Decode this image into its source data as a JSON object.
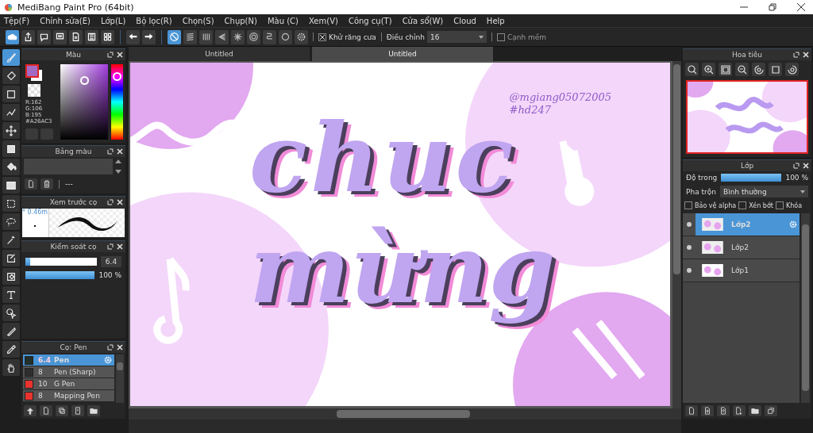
{
  "window": {
    "title": "MediBang Paint Pro (64bit)"
  },
  "menu": [
    "Tệp(F)",
    "Chỉnh sửa(E)",
    "Lớp(L)",
    "Bộ lọc(R)",
    "Chọn(S)",
    "Chụp(N)",
    "Màu (C)",
    "Xem(V)",
    "Công cụ(T)",
    "Cửa sổ(W)",
    "Cloud",
    "Help"
  ],
  "toolbar": {
    "snaps": [
      {
        "selected": true
      },
      {
        "selected": false
      },
      {
        "selected": false
      },
      {
        "selected": false
      },
      {
        "selected": false
      },
      {
        "selected": false
      },
      {
        "selected": false
      },
      {
        "selected": false
      }
    ],
    "antialias": {
      "label": "Khử răng cưa",
      "checked": true
    },
    "correction": {
      "label": "Điều chỉnh",
      "value": "16"
    },
    "soft_edge": {
      "label": "Cạnh mềm",
      "checked": false
    }
  },
  "tools": [
    {
      "selected": true
    },
    {
      "selected": false
    },
    {
      "selected": false
    },
    {
      "selected": false
    },
    {
      "selected": false
    },
    {
      "selected": false
    },
    {
      "selected": false
    },
    {
      "selected": false
    },
    {
      "selected": false
    },
    {
      "selected": false
    },
    {
      "selected": false
    },
    {
      "selected": false
    },
    {
      "selected": false
    },
    {
      "selected": false
    },
    {
      "selected": false
    },
    {
      "selected": false
    },
    {
      "selected": false
    },
    {
      "selected": false
    }
  ],
  "color_panel": {
    "title": "Màu",
    "readout": [
      "R:162",
      "G:106",
      "B:195",
      "#A26AC3"
    ]
  },
  "palette_panel": {
    "title": "Bảng màu",
    "name": "---"
  },
  "brush_preview": {
    "title": "Xem trước cọ",
    "size": "* 0.46m"
  },
  "brush_control": {
    "title": "Kiểm soát cọ",
    "size_slider": {
      "level": 0.07
    },
    "size": "6.4",
    "opacity_slider": {
      "level": 1
    },
    "opacity": "100 %"
  },
  "brush_panel": {
    "title": "Cọ: Pen",
    "brushes": [
      {
        "size": "6.4",
        "name": "Pen",
        "color": "#23302a",
        "selected": true
      },
      {
        "size": "8",
        "name": "Pen (Sharp)",
        "color": "#2e2e2e",
        "selected": false
      },
      {
        "size": "10",
        "name": "G Pen",
        "color": "#e8342f",
        "selected": false
      },
      {
        "size": "8",
        "name": "Mapping Pen",
        "color": "#e8342f",
        "selected": false
      }
    ]
  },
  "document_tabs": [
    {
      "label": "Untitled",
      "selected": false
    },
    {
      "label": "Untitled",
      "selected": true
    }
  ],
  "canvas": {
    "signature": [
      "@mgiang05072005",
      "#hd247"
    ],
    "lettering": [
      "chuc",
      "mừng"
    ]
  },
  "navigator": {
    "title": "Hoa tiêu"
  },
  "layer_panel": {
    "title": "Lớp",
    "opacity_label": "Độ trong",
    "opacity_slider": {
      "level": 1
    },
    "opacity": "100 %",
    "blend_label": "Pha trộn",
    "blend": "Bình thường",
    "options": [
      {
        "label": "Bảo vệ alpha",
        "checked": false
      },
      {
        "label": "Xén bớt",
        "checked": false
      },
      {
        "label": "Khóa",
        "checked": false
      }
    ],
    "layers": [
      {
        "name": "Lớp2",
        "selected": true
      },
      {
        "name": "Lớp2",
        "selected": false
      },
      {
        "name": "Lớp1",
        "selected": false
      }
    ]
  }
}
